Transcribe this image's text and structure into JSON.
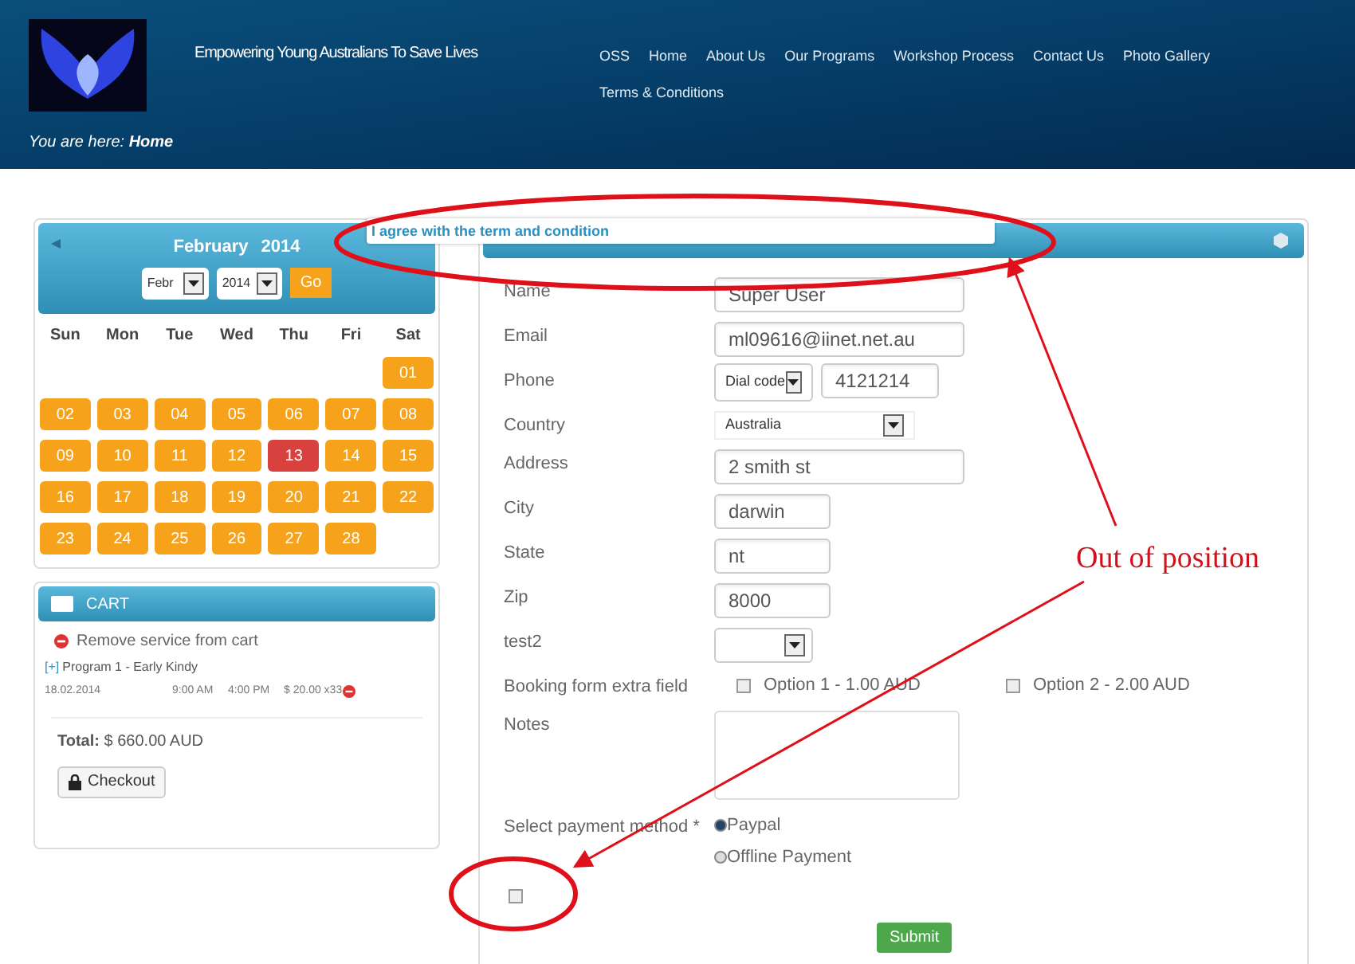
{
  "header": {
    "tagline": "Empowering Young Australians To Save Lives",
    "breadcrumb": "You are here: **Home**",
    "nav": [
      {
        "label": "OSS"
      },
      {
        "label": "Home"
      },
      {
        "label": "About Us"
      },
      {
        "label": "Our Programs"
      },
      {
        "label": "Workshop Process"
      },
      {
        "label": "Contact Us"
      },
      {
        "label": "Photo Gallery"
      },
      {
        "label": "Terms & Conditions"
      }
    ]
  },
  "calendar": {
    "month": "February",
    "year": "2014",
    "month_select": "Febr",
    "year_select": "2014",
    "go_button": "Go",
    "weekdays": [
      "Sun",
      "Mon",
      "Tue",
      "Wed",
      "Thu",
      "Fri",
      "Sat"
    ],
    "days": [
      {
        "kind": "blank"
      },
      {
        "kind": "blank"
      },
      {
        "kind": "blank"
      },
      {
        "kind": "blank"
      },
      {
        "kind": "blank"
      },
      {
        "kind": "blank"
      },
      {
        "kind": "day",
        "label": "01",
        "selected": false
      },
      {
        "kind": "day",
        "label": "02",
        "selected": false
      },
      {
        "kind": "day",
        "label": "03",
        "selected": false
      },
      {
        "kind": "day",
        "label": "04",
        "selected": false
      },
      {
        "kind": "day",
        "label": "05",
        "selected": false
      },
      {
        "kind": "day",
        "label": "06",
        "selected": false
      },
      {
        "kind": "day",
        "label": "07",
        "selected": false
      },
      {
        "kind": "day",
        "label": "08",
        "selected": false
      },
      {
        "kind": "day",
        "label": "09",
        "selected": false
      },
      {
        "kind": "day",
        "label": "10",
        "selected": false
      },
      {
        "kind": "day",
        "label": "11",
        "selected": false
      },
      {
        "kind": "day",
        "label": "12",
        "selected": false
      },
      {
        "kind": "day",
        "label": "13",
        "selected": true
      },
      {
        "kind": "day",
        "label": "14",
        "selected": false
      },
      {
        "kind": "day",
        "label": "15",
        "selected": false
      },
      {
        "kind": "day",
        "label": "16",
        "selected": false
      },
      {
        "kind": "day",
        "label": "17",
        "selected": false
      },
      {
        "kind": "day",
        "label": "18",
        "selected": false
      },
      {
        "kind": "day",
        "label": "19",
        "selected": false
      },
      {
        "kind": "day",
        "label": "20",
        "selected": false
      },
      {
        "kind": "day",
        "label": "21",
        "selected": false
      },
      {
        "kind": "day",
        "label": "22",
        "selected": false
      },
      {
        "kind": "day",
        "label": "23",
        "selected": false
      },
      {
        "kind": "day",
        "label": "24",
        "selected": false
      },
      {
        "kind": "day",
        "label": "25",
        "selected": false
      },
      {
        "kind": "day",
        "label": "26",
        "selected": false
      },
      {
        "kind": "day",
        "label": "27",
        "selected": false
      },
      {
        "kind": "day",
        "label": "28",
        "selected": false
      }
    ]
  },
  "cart": {
    "title": "CART",
    "remove_all": "Remove service from cart",
    "expand": "[+]",
    "item": "Program 1 - Early Kindy",
    "item_cells": [
      "18.02.2014",
      "9:00 AM",
      "4:00 PM",
      "$ 20.00 x33"
    ],
    "total": "**Total:** $ 660.00 AUD",
    "checkout": "Checkout"
  },
  "form": {
    "agree_label": "I agree with the term and condition",
    "agree_checked": false,
    "fields": [
      {
        "kind": "text",
        "label": "Name",
        "value": "Super User",
        "wide": true
      },
      {
        "kind": "text",
        "label": "Email",
        "value": "ml09616@iinet.net.au",
        "wide": true
      },
      {
        "kind": "phone",
        "label": "Phone",
        "select": "Dial code",
        "value": "4121214"
      },
      {
        "kind": "select",
        "label": "Country",
        "value": "Australia"
      },
      {
        "kind": "text",
        "label": "Address",
        "value": "2 smith st",
        "wide": true
      },
      {
        "kind": "text",
        "label": "City",
        "value": "darwin",
        "wide": false
      },
      {
        "kind": "text",
        "label": "State",
        "value": "nt",
        "wide": false
      },
      {
        "kind": "text",
        "label": "Zip",
        "value": "8000",
        "wide": false
      },
      {
        "kind": "emptyselect",
        "label": "test2"
      },
      {
        "kind": "checks",
        "label": "Booking form extra field",
        "options": [
          {
            "label": "Option 1 - 1.00 AUD",
            "checked": false
          },
          {
            "label": "Option 2 - 2.00 AUD",
            "checked": false
          }
        ]
      },
      {
        "kind": "textarea",
        "label": "Notes"
      },
      {
        "kind": "radio",
        "label": "Select payment method *",
        "options": [
          {
            "label": "Paypal",
            "selected": true
          },
          {
            "label": "Offline Payment",
            "selected": false
          }
        ]
      }
    ],
    "submit": "Submit"
  },
  "annotation": {
    "text": "Out of position"
  }
}
